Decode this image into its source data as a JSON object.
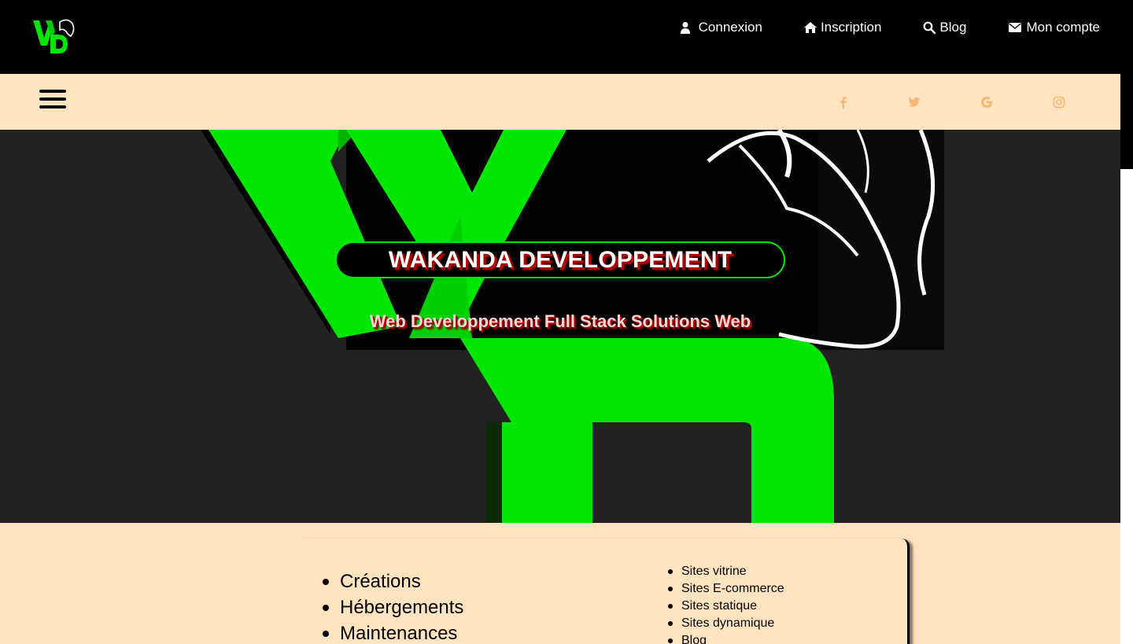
{
  "brand": {
    "logo_letters": "WD"
  },
  "topnav": [
    {
      "label": "Connexion",
      "icon": "user-icon"
    },
    {
      "label": "Inscription",
      "icon": "home-icon"
    },
    {
      "label": "Blog",
      "icon": "search-icon"
    },
    {
      "label": "Mon compte",
      "icon": "envelope-icon"
    }
  ],
  "subbar": {
    "menu_icon": "hamburger-icon",
    "social": [
      "facebook-icon",
      "twitter-icon",
      "google-icon",
      "instagram-icon"
    ]
  },
  "hero": {
    "title": "WAKANDA DEVELOPPEMENT",
    "subtitle": "Web Developpement Full Stack Solutions Web"
  },
  "services": {
    "main": [
      "Créations",
      "Hébergements",
      "Maintenances"
    ],
    "sub": [
      "Sites vitrine",
      "Sites E-commerce",
      "Sites statique",
      "Sites dynamique",
      "Blog"
    ]
  },
  "colors": {
    "topbar": "#000000",
    "beige": "#ffe4bf",
    "hero_bg": "#222222",
    "accent_green": "#00e600",
    "social_icon": "#f4b870",
    "title_shadow": "#b20000"
  }
}
